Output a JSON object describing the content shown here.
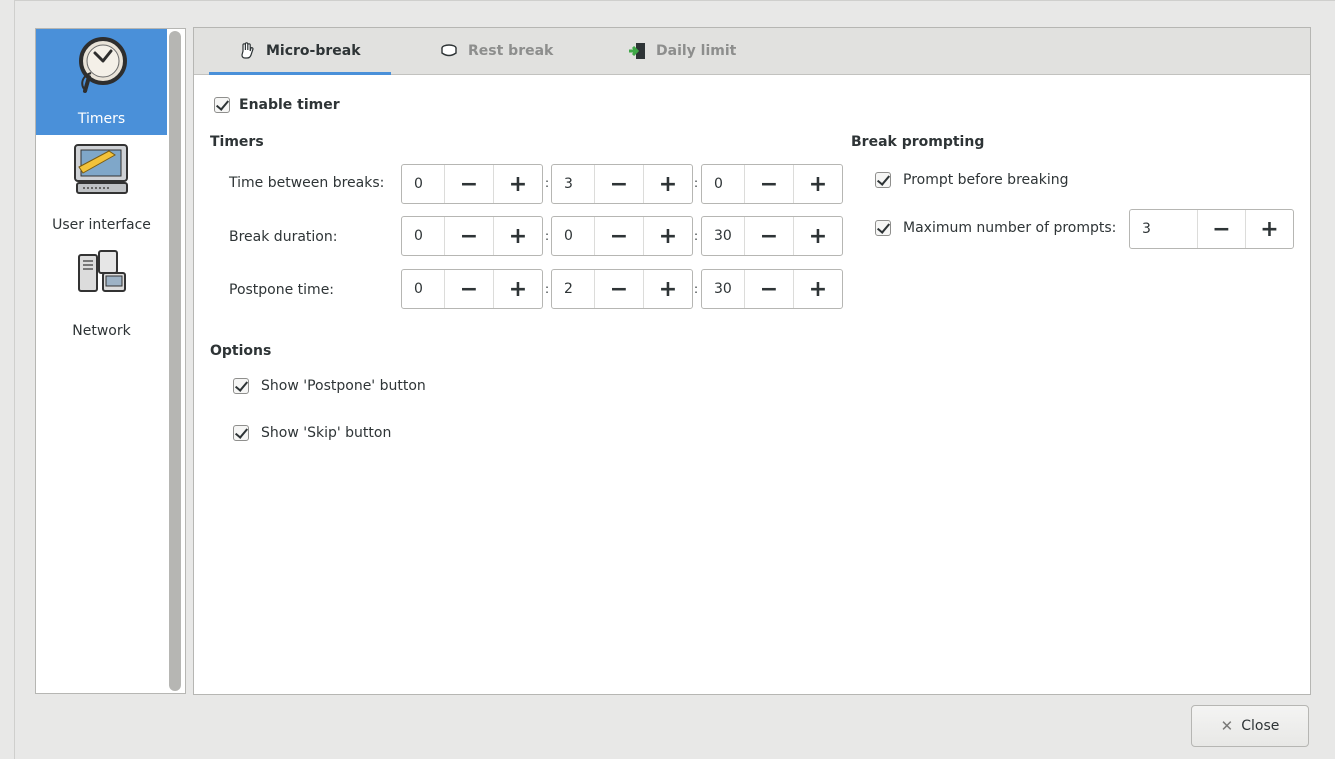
{
  "sidebar": {
    "items": [
      {
        "label": "Timers",
        "icon": "clock-icon",
        "selected": true
      },
      {
        "label": "User interface",
        "icon": "monitor-icon",
        "selected": false
      },
      {
        "label": "Network",
        "icon": "network-icon",
        "selected": false
      }
    ]
  },
  "tabs": [
    {
      "label": "Micro-break",
      "icon": "hand-icon",
      "active": true
    },
    {
      "label": "Rest break",
      "icon": "cup-icon",
      "active": false
    },
    {
      "label": "Daily limit",
      "icon": "exit-icon",
      "active": false
    }
  ],
  "enable_timer": {
    "label": "Enable timer",
    "checked": true
  },
  "timers": {
    "title": "Timers",
    "rows": [
      {
        "label": "Time between breaks:",
        "hours": "0",
        "minutes": "3",
        "seconds": "0"
      },
      {
        "label": "Break duration:",
        "hours": "0",
        "minutes": "0",
        "seconds": "30"
      },
      {
        "label": "Postpone time:",
        "hours": "0",
        "minutes": "2",
        "seconds": "30"
      }
    ]
  },
  "break_prompting": {
    "title": "Break prompting",
    "prompt_before": {
      "label": "Prompt before breaking",
      "checked": true
    },
    "max_prompts": {
      "label": "Maximum number of prompts:",
      "checked": true,
      "value": "3"
    }
  },
  "options": {
    "title": "Options",
    "show_postpone": {
      "label": "Show 'Postpone' button",
      "checked": true
    },
    "show_skip": {
      "label": "Show 'Skip' button",
      "checked": true
    }
  },
  "spin": {
    "minus": "−",
    "plus": "+",
    "separator": ":"
  },
  "footer": {
    "close_label": "Close"
  },
  "colors": {
    "accent": "#4a90d9",
    "background": "#e8e8e7"
  }
}
